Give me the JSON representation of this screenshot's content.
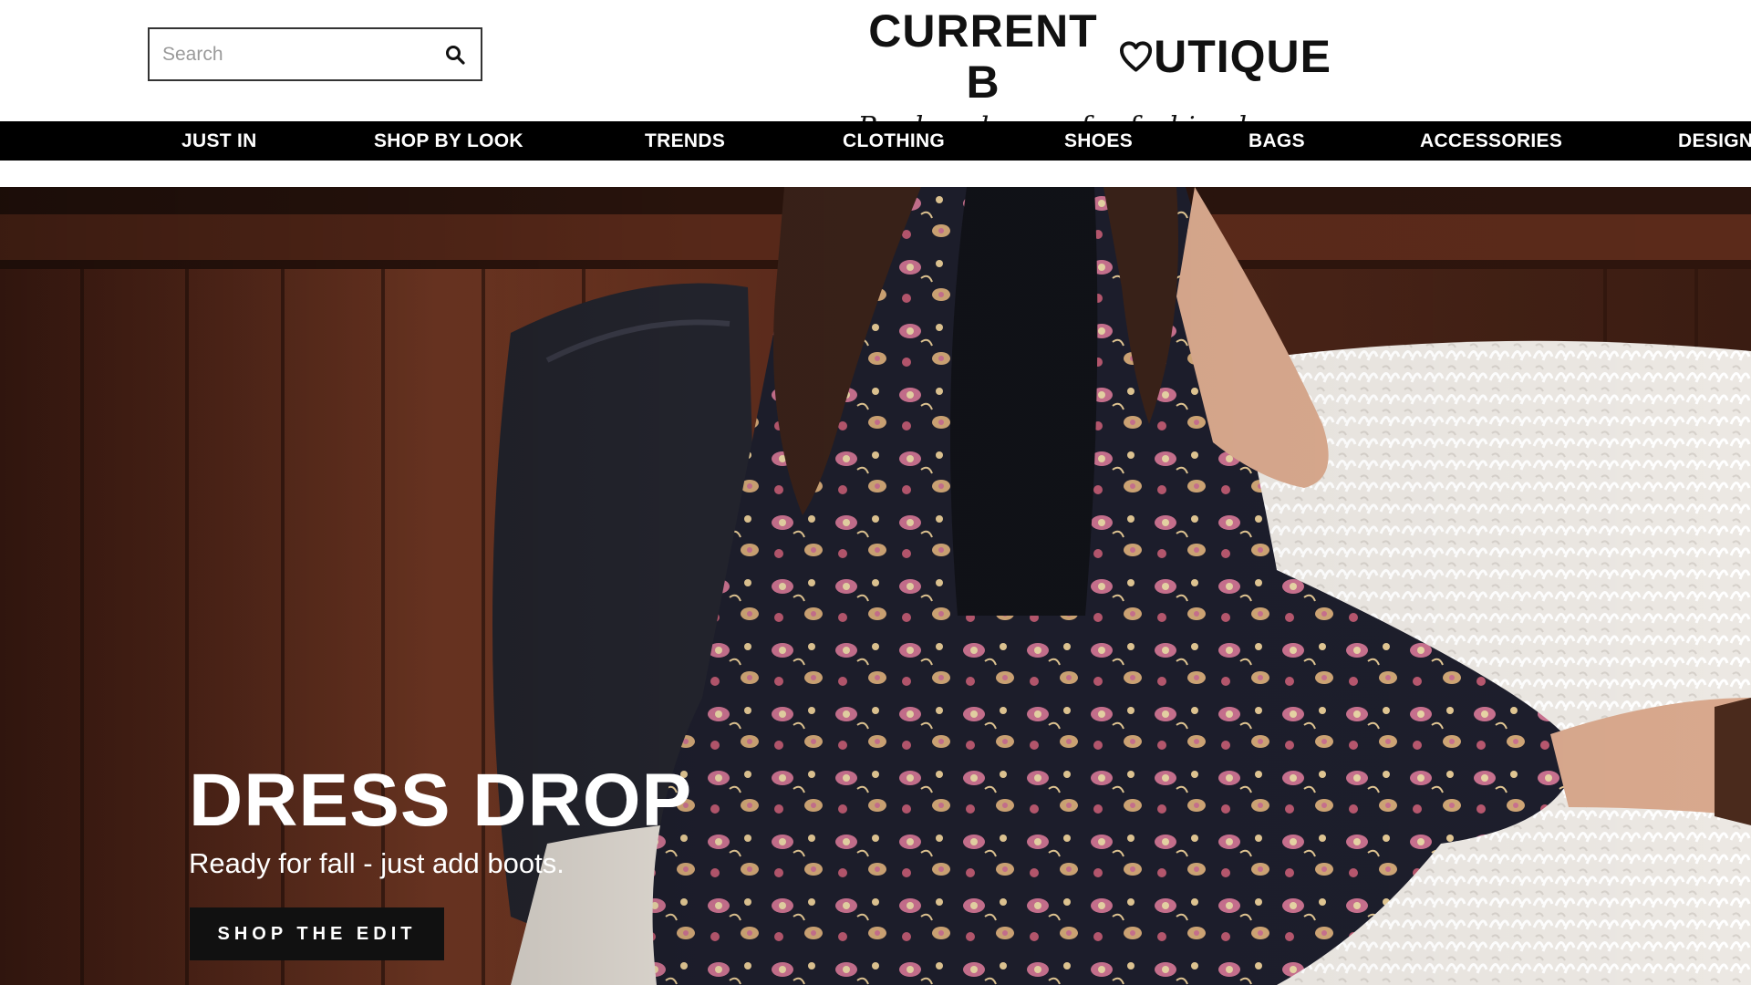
{
  "header": {
    "search": {
      "placeholder": "Search",
      "value": ""
    },
    "search_icon": "search-icon",
    "logo": {
      "title_before": "CURRENT B",
      "title_after": "UTIQUE",
      "tagline": "Pre-loved gems for fashion lovers"
    }
  },
  "nav": {
    "items": [
      {
        "label": "JUST IN"
      },
      {
        "label": "SHOP BY LOOK"
      },
      {
        "label": "TRENDS"
      },
      {
        "label": "CLOTHING"
      },
      {
        "label": "SHOES"
      },
      {
        "label": "BAGS"
      },
      {
        "label": "ACCESSORIES"
      },
      {
        "label": "DESIGN"
      }
    ]
  },
  "hero": {
    "title": "DRESS DROP",
    "subtitle": "Ready for fall - just add boots.",
    "cta": "SHOP THE EDIT"
  },
  "colors": {
    "nav_bg": "#000000",
    "nav_text": "#ffffff",
    "cta_bg": "#111111",
    "wood": "#6b3623"
  }
}
